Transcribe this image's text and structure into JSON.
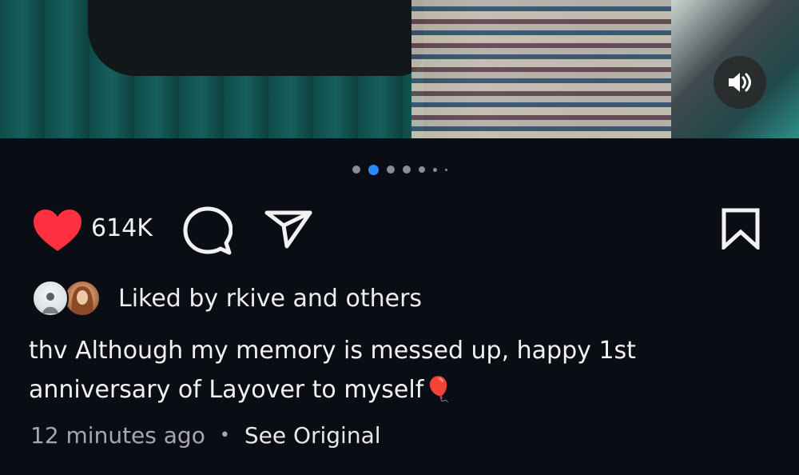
{
  "post": {
    "media": {
      "carousel_total": 7,
      "carousel_active_index": 1,
      "sound_icon": "volume-icon"
    },
    "actions": {
      "like_icon": "heart-filled-icon",
      "like_color": "#ff3040",
      "like_count": "614K",
      "comment_icon": "comment-bubble-icon",
      "share_icon": "paper-plane-icon",
      "save_icon": "bookmark-icon"
    },
    "liked_by": {
      "text": "Liked by rkive and others"
    },
    "caption": {
      "text": "thv Although my memory is messed up, happy 1st anniversary of Layover to myself🎈"
    },
    "meta": {
      "time": "12 minutes ago",
      "separator": "•",
      "see_original": "See Original"
    }
  },
  "colors": {
    "background": "#0b0d14",
    "accent": "#2d88ff",
    "muted_text": "#a6a8ad"
  }
}
